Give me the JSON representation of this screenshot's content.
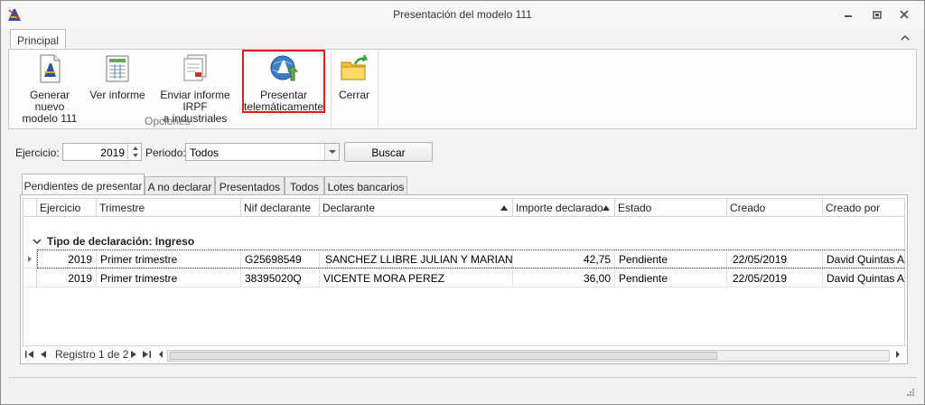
{
  "window": {
    "title": "Presentación del modelo 111"
  },
  "ribbon": {
    "tab": "Principal",
    "buttons": {
      "generar": "Generar nuevo\nmodelo 111",
      "ver": "Ver informe",
      "enviar": "Enviar informe IRPF\na industriales",
      "presentar": "Presentar\ntelemáticamente",
      "cerrar": "Cerrar"
    },
    "group_label": "Opciones"
  },
  "filters": {
    "ejercicio_label": "Ejercicio:",
    "ejercicio_value": "2019",
    "periodo_label": "Periodo:",
    "periodo_value": "Todos",
    "buscar_label": "Buscar"
  },
  "grid_tabs": [
    "Pendientes de presentar",
    "A no declarar",
    "Presentados",
    "Todos",
    "Lotes bancarios"
  ],
  "grid": {
    "columns": [
      "Ejercicio",
      "Trimestre",
      "Nif declarante",
      "Declarante",
      "Importe declarado",
      "Estado",
      "Creado",
      "Creado por"
    ],
    "group_label": "Tipo de declaración: Ingreso",
    "rows": [
      [
        "2019",
        "Primer trimestre",
        "G25698549",
        "SANCHEZ LLIBRE JULIAN Y MARIANO C B",
        "42,75",
        "Pendiente",
        "22/05/2019",
        "David Quintas Alca"
      ],
      [
        "2019",
        "Primer trimestre",
        "38395020Q",
        "VICENTE MORA PEREZ",
        "36,00",
        "Pendiente",
        "22/05/2019",
        "David Quintas Alca"
      ]
    ]
  },
  "navigator": {
    "record_text": "Registro 1 de 2"
  },
  "colors": {
    "highlight": "#e0191a"
  }
}
